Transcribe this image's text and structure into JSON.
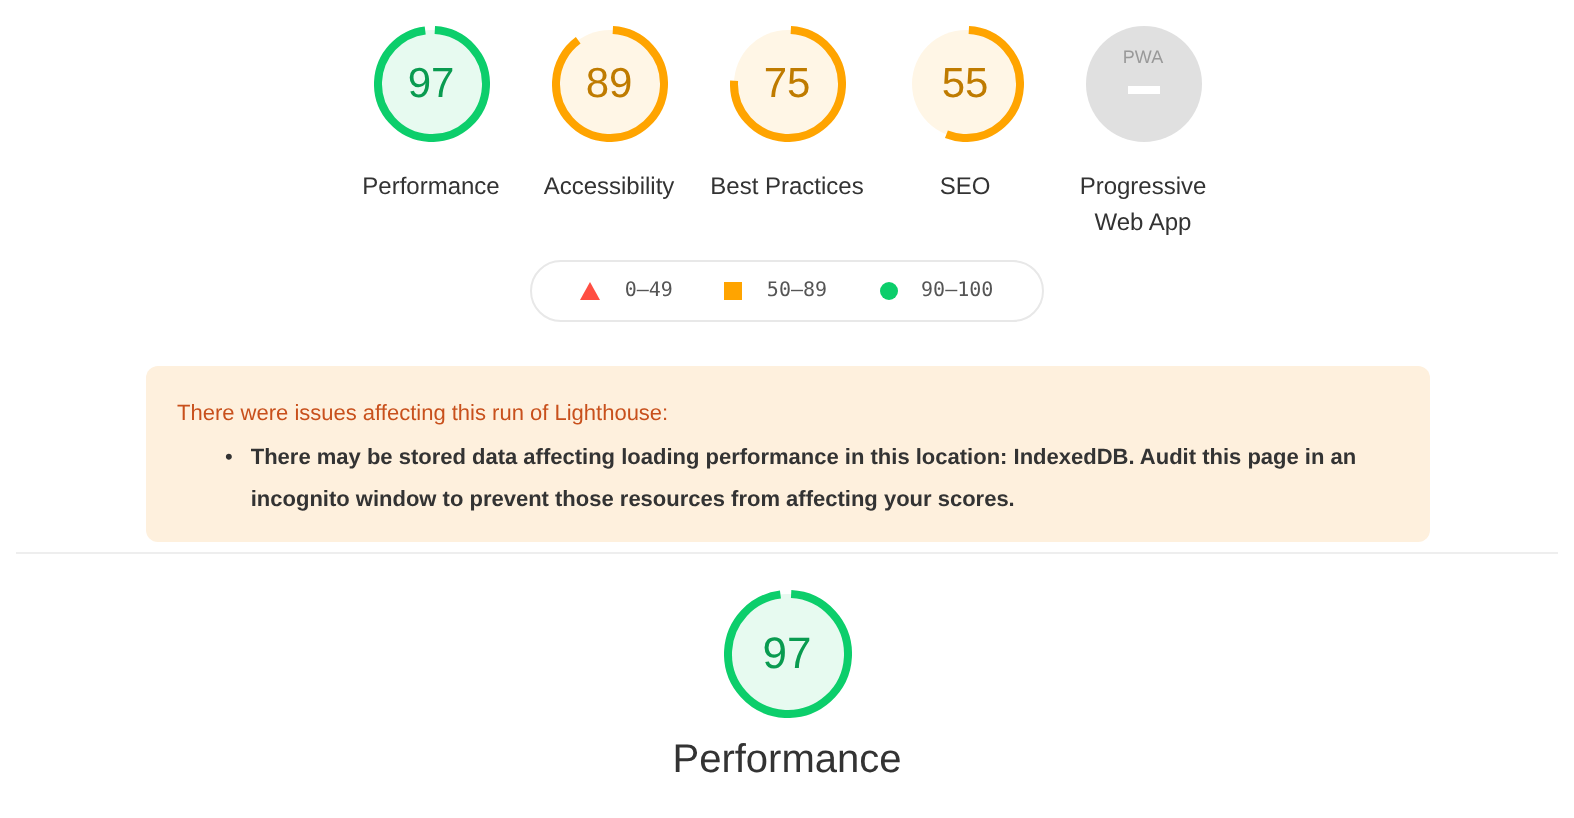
{
  "gauges": [
    {
      "kind": "score",
      "score": "97",
      "level": 0.97,
      "color": "#0cce6b",
      "label": "Performance"
    },
    {
      "kind": "score",
      "score": "89",
      "level": 0.89,
      "color": "#ffa400",
      "label": "Accessibility"
    },
    {
      "kind": "score",
      "score": "75",
      "level": 0.75,
      "color": "#ffa400",
      "label": "Best Practices"
    },
    {
      "kind": "score",
      "score": "55",
      "level": 0.55,
      "color": "#ffa400",
      "label": "SEO"
    },
    {
      "kind": "pwa",
      "badge": "PWA",
      "label": "Progressive Web App"
    }
  ],
  "legend": [
    {
      "kind": "triangle",
      "color": "#ff4e42",
      "range": "0–49"
    },
    {
      "kind": "square",
      "color": "#ffa400",
      "range": "50–89"
    },
    {
      "kind": "circle",
      "color": "#0cce6b",
      "range": "90–100"
    }
  ],
  "warning": {
    "title": "There were issues affecting this run of Lighthouse:",
    "items": [
      {
        "bullet": "•",
        "text": "There may be stored data affecting loading performance in this location: IndexedDB. Audit this page in an incognito window to prevent those resources from affecting your scores."
      }
    ]
  },
  "category": {
    "score": "97",
    "level": 0.97,
    "color": "#0cce6b",
    "label": "Performance"
  }
}
